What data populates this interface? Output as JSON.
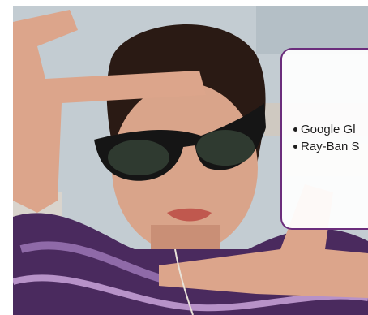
{
  "photo": {
    "subject": "person-framing-hands-with-sunglasses-icon"
  },
  "callout": {
    "bullets": [
      {
        "label": "Google Gl"
      },
      {
        "label": "Ray-Ban S"
      }
    ],
    "border_color": "#6b2d7c"
  }
}
